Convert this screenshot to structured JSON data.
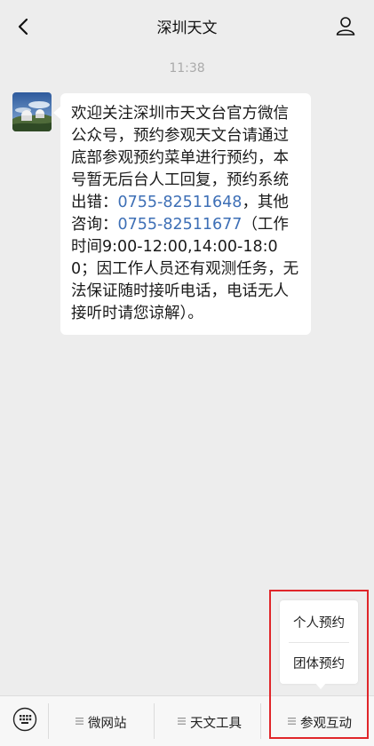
{
  "header": {
    "title": "深圳天文"
  },
  "chat": {
    "time": "11:38",
    "message": {
      "part1": "欢迎关注深圳市天文台官方微信公众号，预约参观天文台请通过底部参观预约菜单进行预约，本号暂无后台人工回复，预约系统出错：",
      "phone1": "0755-82511648",
      "part2": "，其他咨询：",
      "phone2": "0755-82511677",
      "part3": "（工作时间9:00-12:00,14:00-18:00；因工作人员还有观测任务，无法保证随时接听电话，电话无人接听时请您谅解）。"
    }
  },
  "popup": {
    "items": [
      "个人预约",
      "团体预约"
    ]
  },
  "bottom_menu": {
    "tabs": [
      "微网站",
      "天文工具",
      "参观互动"
    ]
  },
  "colors": {
    "link": "#3d6fb6",
    "highlight_border": "#e0262a",
    "background": "#ededed"
  }
}
